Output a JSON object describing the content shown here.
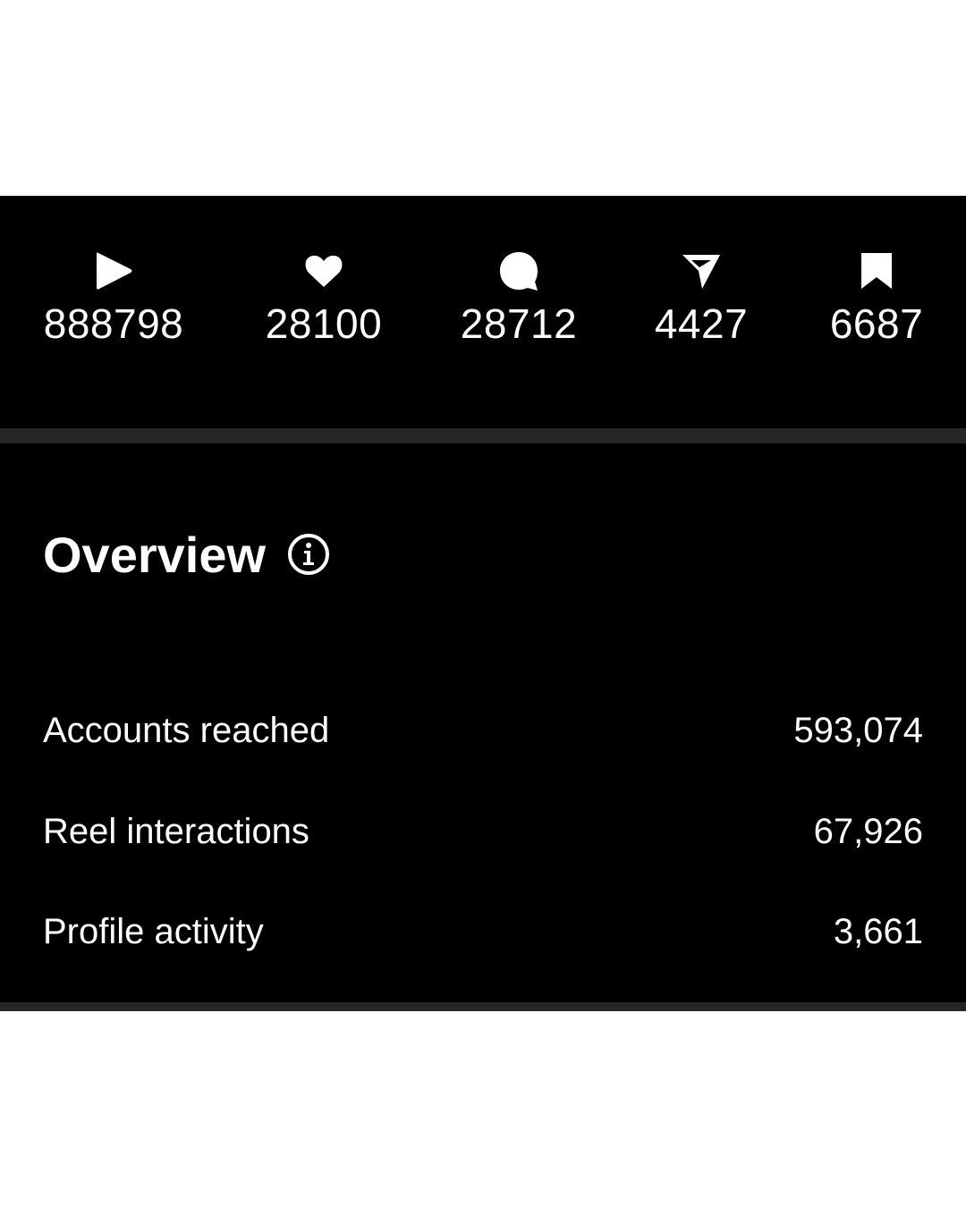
{
  "stats": [
    {
      "icon": "play-icon",
      "value": "888798"
    },
    {
      "icon": "heart-icon",
      "value": "28100"
    },
    {
      "icon": "comment-icon",
      "value": "28712"
    },
    {
      "icon": "share-icon",
      "value": "4427"
    },
    {
      "icon": "bookmark-icon",
      "value": "6687"
    }
  ],
  "overview": {
    "title": "Overview",
    "info_icon": "info-icon",
    "metrics": [
      {
        "label": "Accounts reached",
        "value": "593,074"
      },
      {
        "label": "Reel interactions",
        "value": "67,926"
      },
      {
        "label": "Profile activity",
        "value": "3,661"
      }
    ]
  },
  "colors": {
    "background": "#ffffff",
    "panel": "#000000",
    "text": "#ffffff",
    "divider": "#262626"
  }
}
